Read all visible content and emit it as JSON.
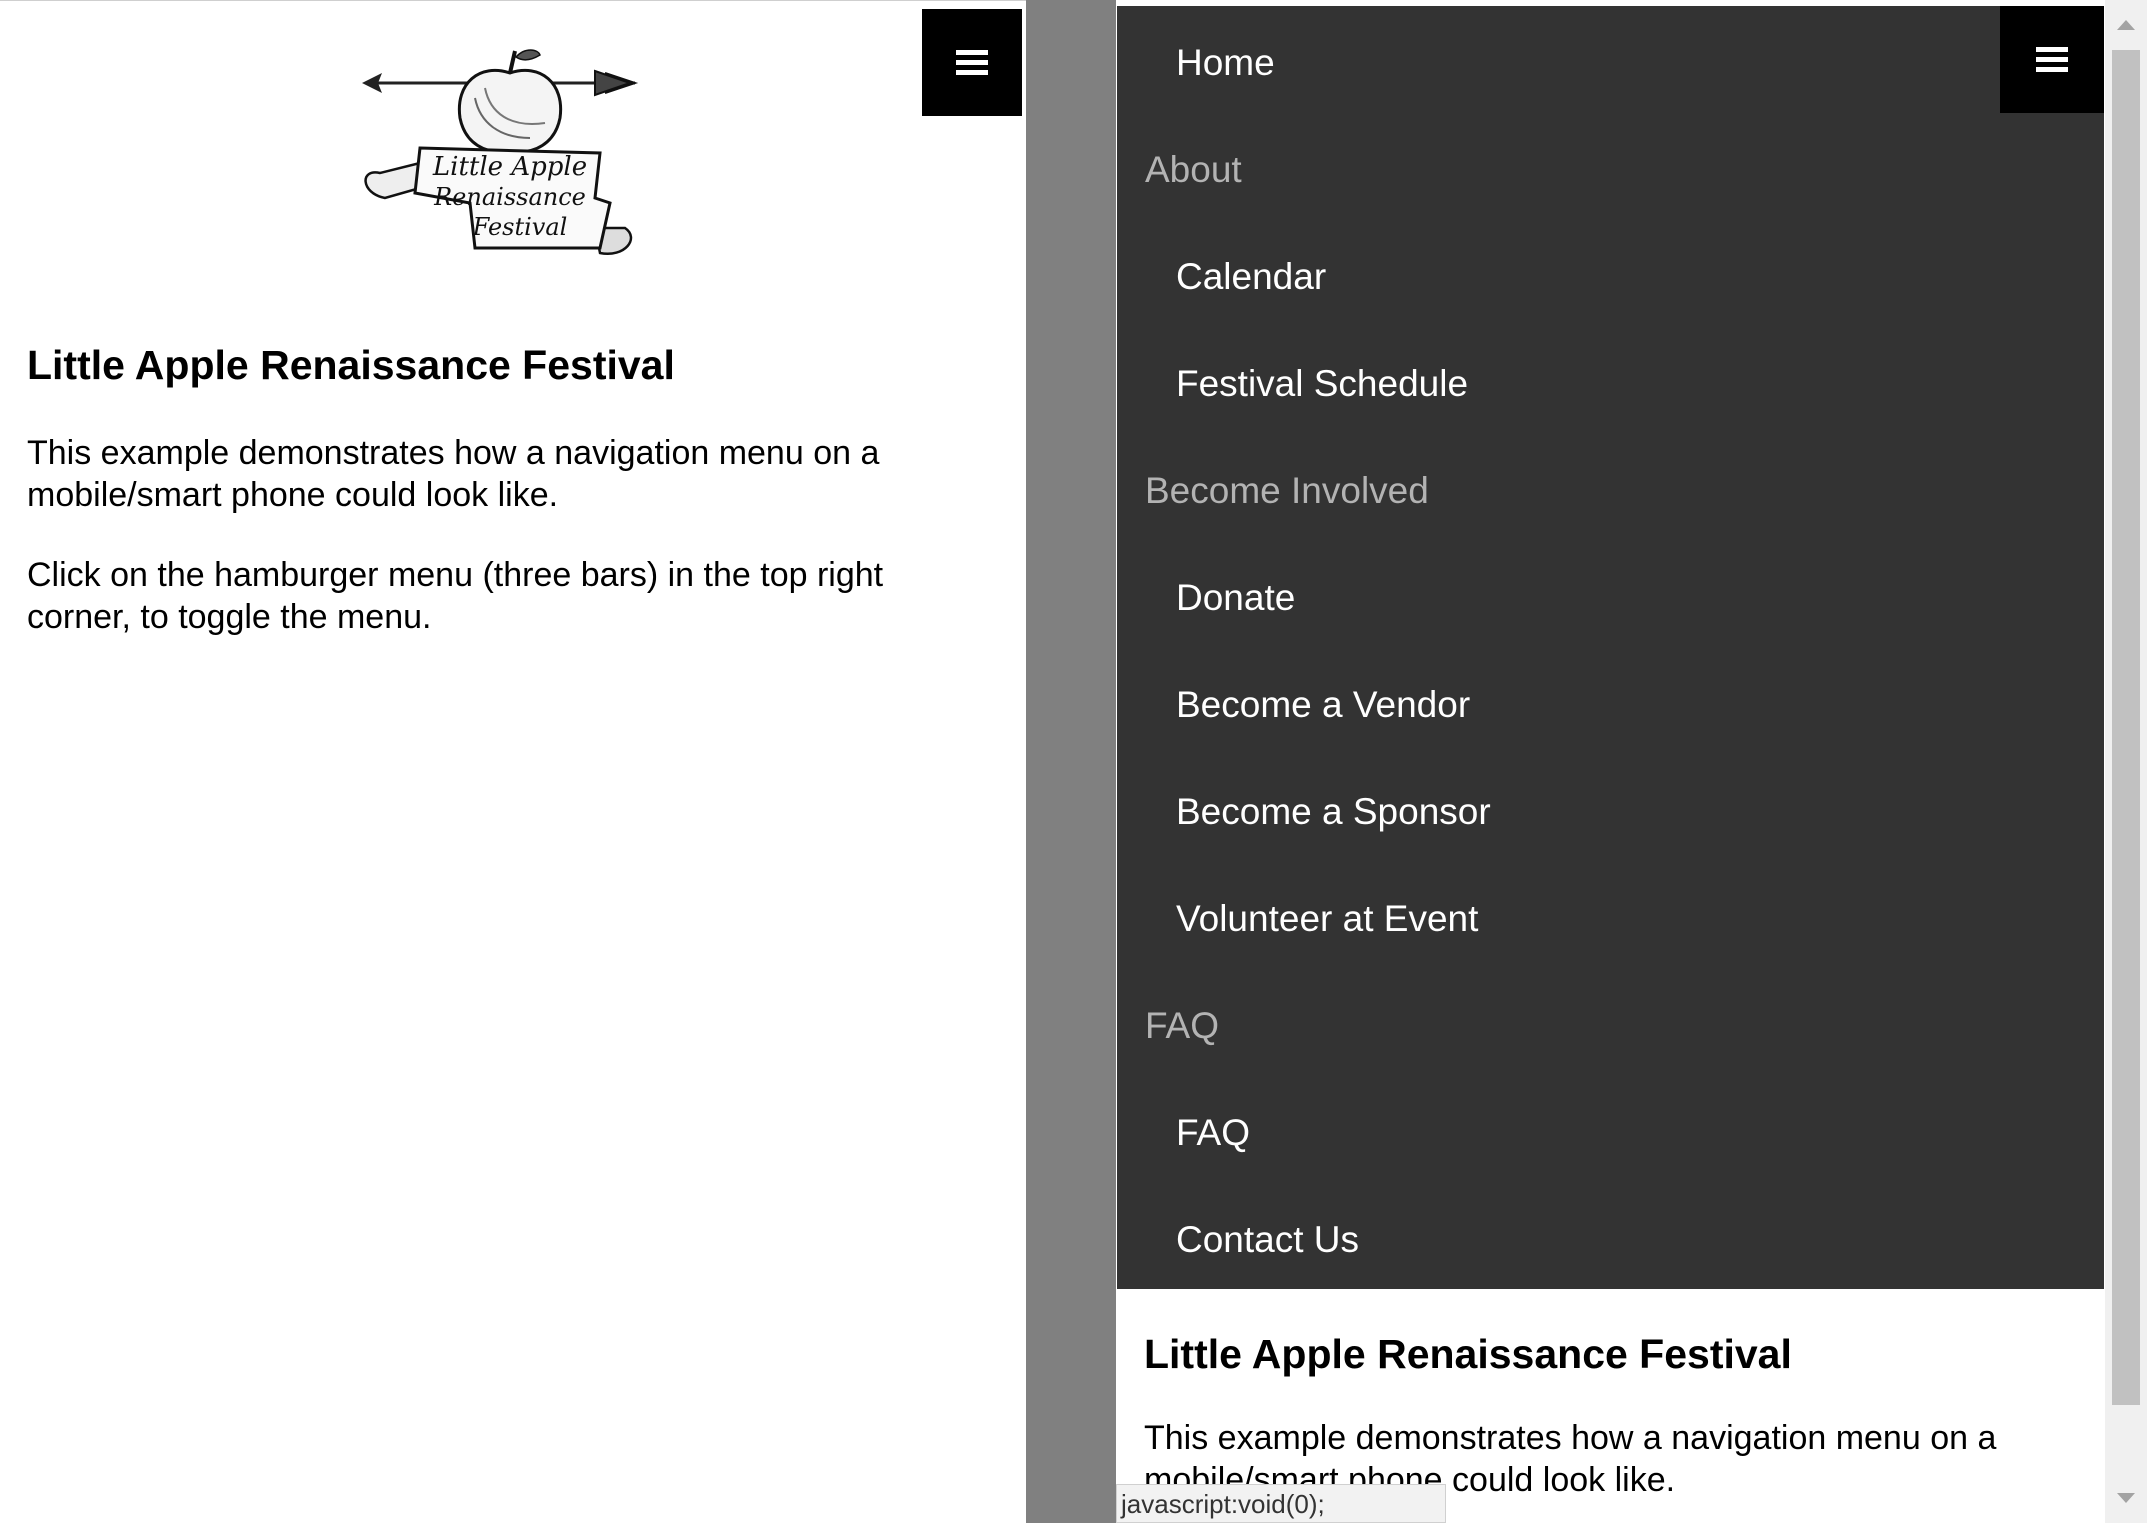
{
  "left": {
    "logo_text": [
      "Little Apple",
      "Renaissance",
      "Festival"
    ],
    "heading": "Little Apple Renaissance Festival",
    "paragraphs": [
      "This example demonstrates how a navigation menu on a mobile/smart phone could look like.",
      "Click on the hamburger menu (three bars) in the top right corner, to toggle the menu."
    ]
  },
  "nav": {
    "items": [
      {
        "label": "Home",
        "type": "link"
      },
      {
        "label": "About",
        "type": "heading"
      },
      {
        "label": "Calendar",
        "type": "link"
      },
      {
        "label": "Festival Schedule",
        "type": "link"
      },
      {
        "label": "Become Involved",
        "type": "heading"
      },
      {
        "label": "Donate",
        "type": "link"
      },
      {
        "label": "Become a Vendor",
        "type": "link"
      },
      {
        "label": "Become a Sponsor",
        "type": "link"
      },
      {
        "label": "Volunteer at Event",
        "type": "link"
      },
      {
        "label": "FAQ",
        "type": "heading"
      },
      {
        "label": "FAQ",
        "type": "link"
      },
      {
        "label": "Contact Us",
        "type": "link"
      }
    ]
  },
  "right": {
    "heading": "Little Apple Renaissance Festival",
    "paragraph": "This example demonstrates how a navigation menu on a mobile/smart phone could look like."
  },
  "status_bar": {
    "text": "javascript:void(0);"
  },
  "colors": {
    "nav_background": "#333333",
    "nav_link": "#ffffff",
    "nav_heading": "#b3b3b3",
    "gutter": "#808080",
    "button": "#000000"
  },
  "icons": [
    "hamburger-icon",
    "apple-logo",
    "scroll-up-arrow-icon",
    "scroll-down-arrow-icon"
  ]
}
